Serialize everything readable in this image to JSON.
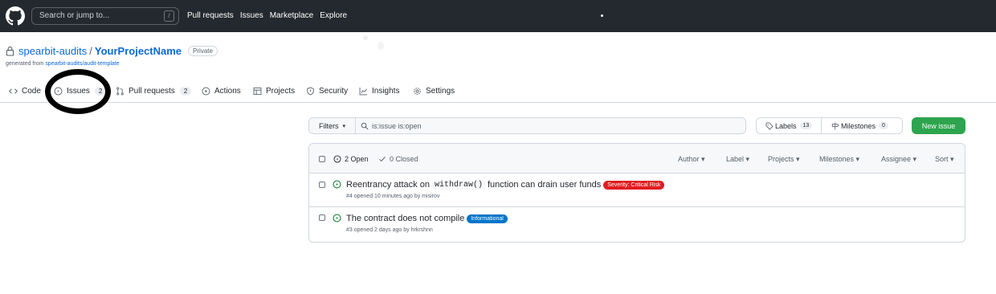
{
  "colors": {
    "header_bg": "#24292f",
    "link": "#0969da",
    "open_green": "#1a7f37",
    "new_issue_green": "#2da44e",
    "critical_label": "#e11d21",
    "informational_label": "#0075ca"
  },
  "header": {
    "search_placeholder": "Search or jump to...",
    "search_key": "/",
    "nav": [
      "Pull requests",
      "Issues",
      "Marketplace",
      "Explore"
    ]
  },
  "repo": {
    "owner": "spearbit-audits",
    "separator": "/",
    "name": "YourProjectName",
    "visibility": "Private",
    "generated_prefix": "generated from ",
    "template": "spearbit-audits/audit-template"
  },
  "tabs": [
    {
      "label": "Code",
      "icon": "code-icon"
    },
    {
      "label": "Issues",
      "count": "2",
      "icon": "issue-opened-icon"
    },
    {
      "label": "Pull requests",
      "count": "2",
      "icon": "git-pull-request-icon"
    },
    {
      "label": "Actions",
      "icon": "play-icon"
    },
    {
      "label": "Projects",
      "icon": "table-icon"
    },
    {
      "label": "Security",
      "icon": "shield-icon"
    },
    {
      "label": "Insights",
      "icon": "graph-icon"
    },
    {
      "label": "Settings",
      "icon": "gear-icon"
    }
  ],
  "toolbar": {
    "filters_label": "Filters",
    "search_value": "is:issue is:open",
    "labels_label": "Labels",
    "labels_count": "13",
    "milestones_label": "Milestones",
    "milestones_count": "0",
    "new_issue_label": "New issue"
  },
  "list_header": {
    "open_label": "2 Open",
    "closed_label": "0 Closed",
    "sort_menus": [
      "Author ▾",
      "Label ▾",
      "Projects ▾",
      "Milestones ▾",
      "Assignee ▾",
      "Sort ▾"
    ]
  },
  "issues": [
    {
      "title_before": "Reentrancy attack on",
      "title_code": "withdraw()",
      "title_after": "function can drain user funds",
      "label": "Severity: Critical Risk",
      "label_color": "#e11d21",
      "meta": "#4 opened 10 minutes ago by misirov"
    },
    {
      "title_before": "The contract does not compile",
      "label": "Informational",
      "label_color": "#0075ca",
      "meta": "#3 opened 2 days ago by hrkrshnn"
    }
  ]
}
